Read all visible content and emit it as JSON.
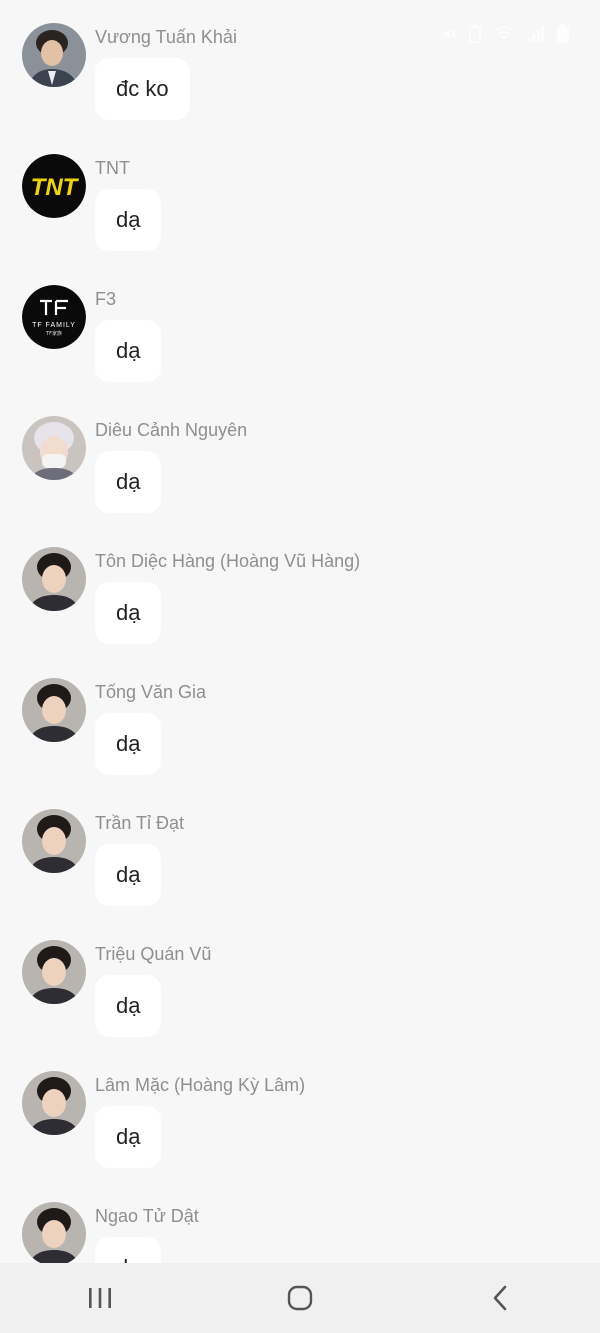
{
  "status_bar": {
    "icons": [
      "mute-icon",
      "battery-saver-icon",
      "wifi-icon",
      "signal-icon",
      "battery-icon"
    ]
  },
  "messages": [
    {
      "sender": "Vương Tuấn Khải",
      "text": "đc ko",
      "avatar": "photo-man-glasses"
    },
    {
      "sender": "TNT",
      "text": "dạ",
      "avatar": "tnt-logo"
    },
    {
      "sender": "F3",
      "text": "dạ",
      "avatar": "tf-family-logo"
    },
    {
      "sender": "Diêu Cảnh Nguyên",
      "text": "dạ",
      "avatar": "photo-silver-hair-mask"
    },
    {
      "sender": "Tôn Diệc Hàng (Hoàng Vũ Hàng)",
      "text": "dạ",
      "avatar": "photo-young-man"
    },
    {
      "sender": "Tống Văn Gia",
      "text": "dạ",
      "avatar": "photo-young-man"
    },
    {
      "sender": "Trần Tỉ Đạt",
      "text": "dạ",
      "avatar": "photo-young-man"
    },
    {
      "sender": "Triệu Quán Vũ",
      "text": "dạ",
      "avatar": "photo-young-man"
    },
    {
      "sender": "Lâm Mặc (Hoàng Kỳ Lâm)",
      "text": "dạ",
      "avatar": "photo-young-man"
    },
    {
      "sender": "Ngao Tử Dật",
      "text": "dạ",
      "avatar": "photo-young-man"
    }
  ],
  "nav_bar": {
    "buttons": [
      "recent-apps-icon",
      "home-icon",
      "back-icon"
    ]
  },
  "logos": {
    "tnt": "TNT",
    "tf_family": "TF FAMILY",
    "tf_sub": "TF家族"
  },
  "colors": {
    "background": "#f7f7f7",
    "bubble": "#ffffff",
    "sender_text": "#8f8f8f",
    "message_text": "#222222",
    "tnt_yellow": "#f2d400",
    "nav_bar": "#f0f0f0"
  }
}
